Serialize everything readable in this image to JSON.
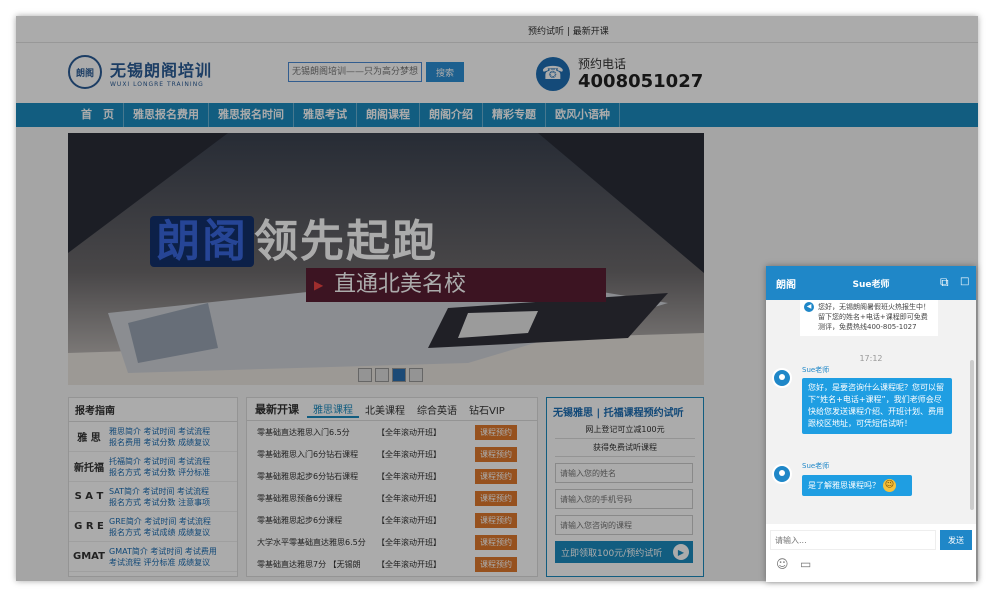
{
  "topbar": {
    "links": "预约试听 | 最新开课"
  },
  "header": {
    "logo_cn": "无锡朗阁培训",
    "logo_en": "WUXI LONGRE TRAINING",
    "search_placeholder": "无锡朗阁培训——只为高分梦想",
    "search_button": "搜索",
    "phone_label": "预约电话",
    "phone_number": "4008051027"
  },
  "nav": [
    "首　页",
    "雅思报名费用",
    "雅思报名时间",
    "雅思考试",
    "朗阁课程",
    "朗阁介绍",
    "精彩专题",
    "欧风小语种"
  ],
  "banner": {
    "title_a": "朗阁",
    "title_b": "领先起跑",
    "subtitle": "直通北美名校"
  },
  "guide": {
    "title": "报考指南",
    "rows": [
      {
        "k": "雅 思",
        "l1": "雅思简介  考试时间  考试流程",
        "l2": "报名费用  考试分数  成绩复议"
      },
      {
        "k": "新托福",
        "l1": "托福简介  考试时间  考试流程",
        "l2": "报名方式  考试分数  评分标准"
      },
      {
        "k": "S A T",
        "l1": "SAT简介  考试时间  考试流程",
        "l2": "报名方式  考试分数  注意事项"
      },
      {
        "k": "G R E",
        "l1": "GRE简介  考试时间  考试流程",
        "l2": "报名方式  考试成绩  成绩复议"
      },
      {
        "k": "GMAT",
        "l1": "GMAT简介 考试时间  考试费用",
        "l2": "考试流程  评分标准  成绩复议"
      }
    ]
  },
  "courses": {
    "heading": "最新开课",
    "tabs": [
      "雅思课程",
      "北美课程",
      "综合英语",
      "钻石VIP"
    ],
    "rows": [
      {
        "n": "零基础直达雅思入门6.5分",
        "s": "【全年滚动开班】"
      },
      {
        "n": "零基础雅思入门6分钻石课程",
        "s": "【全年滚动开班】"
      },
      {
        "n": "零基础雅思起步6分钻石课程",
        "s": "【全年滚动开班】"
      },
      {
        "n": "零基础雅思预备6分课程",
        "s": "【全年滚动开班】"
      },
      {
        "n": "零基础雅思起步6分课程",
        "s": "【全年滚动开班】"
      },
      {
        "n": "大学水平零基础直达雅思6.5分",
        "s": "【全年滚动开班】"
      },
      {
        "n": "零基础直达雅思7分 【无锡朗",
        "s": "【全年滚动开班】"
      }
    ],
    "book_label": "课程预约"
  },
  "form": {
    "title": "无锡雅思 | 托福课程预约试听",
    "line1": "网上登记可立减100元",
    "line2": "获得免费试听课程",
    "name_ph": "请输入您的姓名",
    "phone_ph": "请输入您的手机号码",
    "course_ph": "请输入您咨询的课程",
    "submit": "立即领取100元/预约试听"
  },
  "chat": {
    "logo": "朗阁",
    "title": "Sue老师",
    "system_msg": "您好，无锡朗阁暑假班火热报生中！留下您的姓名+电话+课程即可免费测评，免费热线400-805-1027",
    "time": "17:12",
    "sender": "Sue老师",
    "msg1": "您好，是要咨询什么课程呢？您可以留下“姓名+电话+课程”，我们老师会尽快给您发送课程介绍、开班计划、费用跟校区地址，可凭短信试听！",
    "msg2": "是了解雅思课程吗？",
    "input_ph": "请输入...",
    "send": "发送"
  }
}
